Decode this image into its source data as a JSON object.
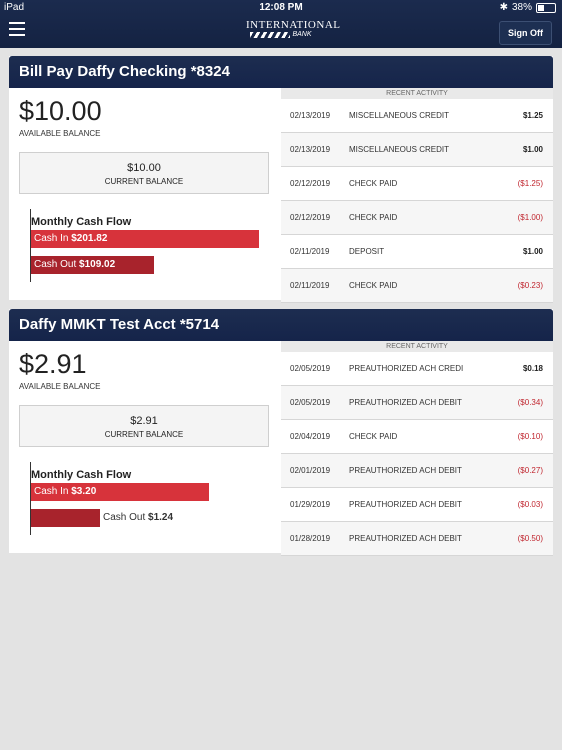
{
  "status_bar": {
    "device": "iPad",
    "time": "12:08 PM",
    "battery": "38%"
  },
  "app": {
    "logo_name": "INTERNATIONAL",
    "logo_sub": "BANK",
    "sign_off_label": "Sign Off"
  },
  "accounts": [
    {
      "title": "Bill Pay Daffy Checking *8324",
      "available_balance": "$10.00",
      "available_label": "AVAILABLE BALANCE",
      "current_balance": "$10.00",
      "current_label": "CURRENT BALANCE",
      "cash_flow_title": "Monthly Cash Flow",
      "cash_in_label": "Cash In",
      "cash_in_value": "$201.82",
      "cash_in_amount": 201.82,
      "cash_out_label": "Cash Out",
      "cash_out_value": "$109.02",
      "cash_out_amount": 109.02,
      "recent_activity_label": "RECENT ACTIVITY",
      "transactions": [
        {
          "date": "02/13/2019",
          "description": "MISCELLANEOUS CREDIT",
          "amount": "$1.25"
        },
        {
          "date": "02/13/2019",
          "description": "MISCELLANEOUS CREDIT",
          "amount": "$1.00"
        },
        {
          "date": "02/12/2019",
          "description": "CHECK PAID",
          "amount": "($1.25)"
        },
        {
          "date": "02/12/2019",
          "description": "CHECK PAID",
          "amount": "($1.00)"
        },
        {
          "date": "02/11/2019",
          "description": "DEPOSIT",
          "amount": "$1.00"
        },
        {
          "date": "02/11/2019",
          "description": "CHECK PAID",
          "amount": "($0.23)"
        }
      ]
    },
    {
      "title": "Daffy MMKT Test Acct *5714",
      "available_balance": "$2.91",
      "available_label": "AVAILABLE BALANCE",
      "current_balance": "$2.91",
      "current_label": "CURRENT BALANCE",
      "cash_flow_title": "Monthly Cash Flow",
      "cash_in_label": "Cash In",
      "cash_in_value": "$3.20",
      "cash_in_amount": 3.2,
      "cash_out_label": "Cash Out",
      "cash_out_value": "$1.24",
      "cash_out_amount": 1.24,
      "recent_activity_label": "RECENT ACTIVITY",
      "transactions": [
        {
          "date": "02/05/2019",
          "description": "PREAUTHORIZED ACH CREDI",
          "amount": "$0.18"
        },
        {
          "date": "02/05/2019",
          "description": "PREAUTHORIZED ACH DEBIT",
          "amount": "($0.34)"
        },
        {
          "date": "02/04/2019",
          "description": "CHECK PAID",
          "amount": "($0.10)"
        },
        {
          "date": "02/01/2019",
          "description": "PREAUTHORIZED ACH DEBIT",
          "amount": "($0.27)"
        },
        {
          "date": "01/29/2019",
          "description": "PREAUTHORIZED ACH DEBIT",
          "amount": "($0.03)"
        },
        {
          "date": "01/28/2019",
          "description": "PREAUTHORIZED ACH DEBIT",
          "amount": "($0.50)"
        }
      ]
    }
  ],
  "colors": {
    "header_navy": "#1b2b4e",
    "cash_in": "#d7333b",
    "cash_out": "#a8232c",
    "negative_amount": "#c0262f"
  }
}
